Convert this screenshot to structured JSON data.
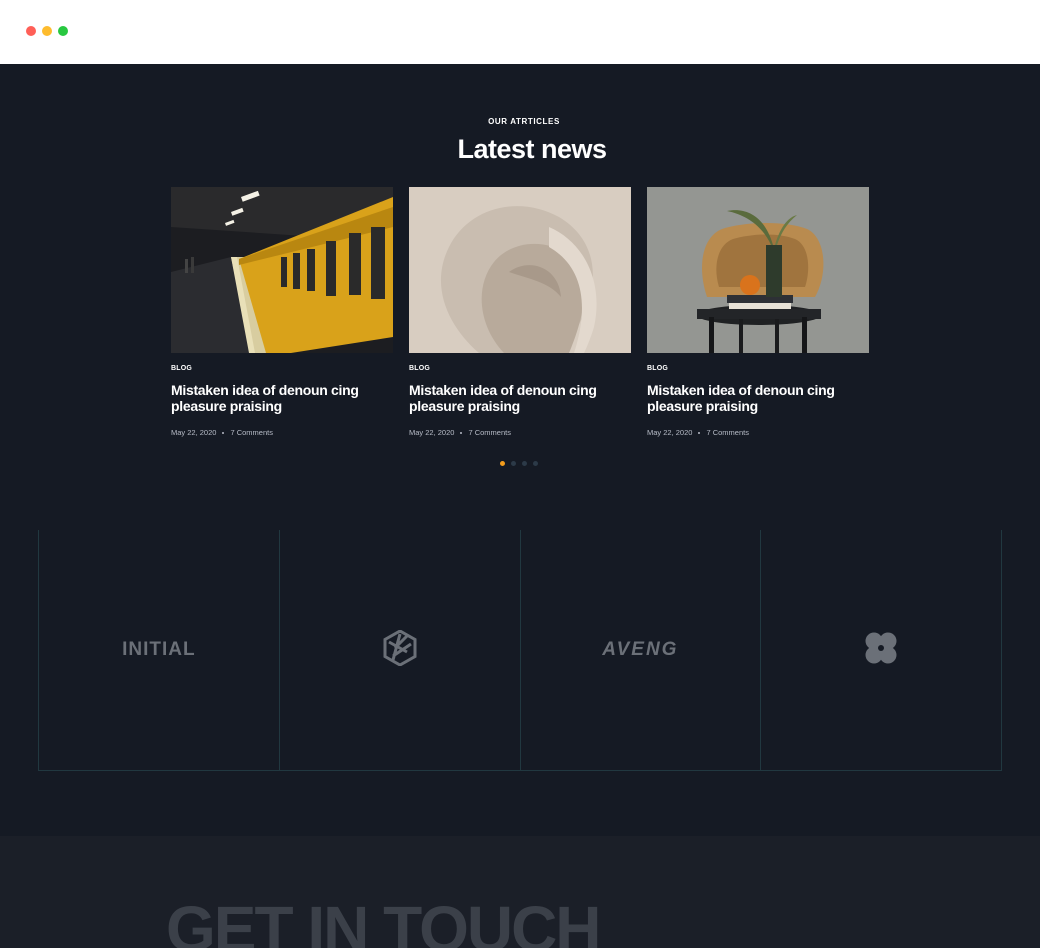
{
  "news": {
    "eyebrow": "OUR ATRTICLES",
    "heading": "Latest news",
    "cards": [
      {
        "tag": "BLOG",
        "title": "Mistaken idea of denoun cing pleasure praising",
        "date": "May 22, 2020",
        "comments": "7 Comments"
      },
      {
        "tag": "BLOG",
        "title": "Mistaken idea of denoun cing pleasure praising",
        "date": "May 22, 2020",
        "comments": "7 Comments"
      },
      {
        "tag": "BLOG",
        "title": "Mistaken idea of denoun cing pleasure praising",
        "date": "May 22, 2020",
        "comments": "7 Comments"
      }
    ],
    "pager": {
      "count": 4,
      "active_index": 0
    }
  },
  "brands": [
    {
      "wordmark": "INITIAL",
      "icon": "initial-logo"
    },
    {
      "wordmark": "",
      "icon": "woven-hexagon-logo"
    },
    {
      "wordmark": "AVENG",
      "icon": "aveng-logo"
    },
    {
      "wordmark": "",
      "icon": "four-petal-logo"
    }
  ],
  "contact": {
    "heading": "GET IN TOUCH"
  },
  "colors": {
    "background": "#151a24",
    "accent": "#f39c1c",
    "divider": "#213840",
    "logo_gray": "#6b7078"
  }
}
